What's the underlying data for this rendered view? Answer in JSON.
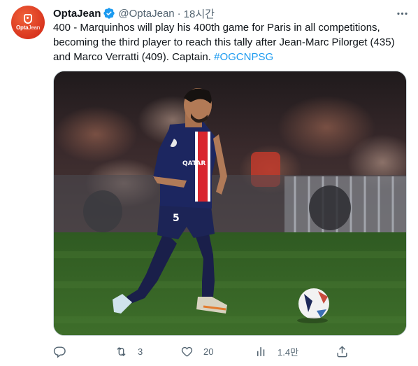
{
  "tweet": {
    "avatar": {
      "logo_text_bold": "Opta",
      "logo_text_light": "Jean",
      "color": "#e04424"
    },
    "display_name": "OptaJean",
    "handle": "@OptaJean",
    "separator": "·",
    "timestamp": "18시간",
    "text_main": "400 - Marquinhos will play his 400th game for Paris in all competitions, becoming the third player to reach this tally after Jean-Marc Pilorget (435) and Marco Verratti (409). Captain. ",
    "hashtag": "#OGCNPSG",
    "media": {
      "jersey_sponsor": "QATAR AIRWAYS",
      "jersey_number": "5"
    },
    "actions": {
      "reply_count": "",
      "retweet_count": "3",
      "like_count": "20",
      "views_count": "1.4만",
      "share_count": ""
    }
  },
  "colors": {
    "accent": "#1d9bf0",
    "secondary_text": "#536471",
    "primary_text": "#0f1419"
  }
}
